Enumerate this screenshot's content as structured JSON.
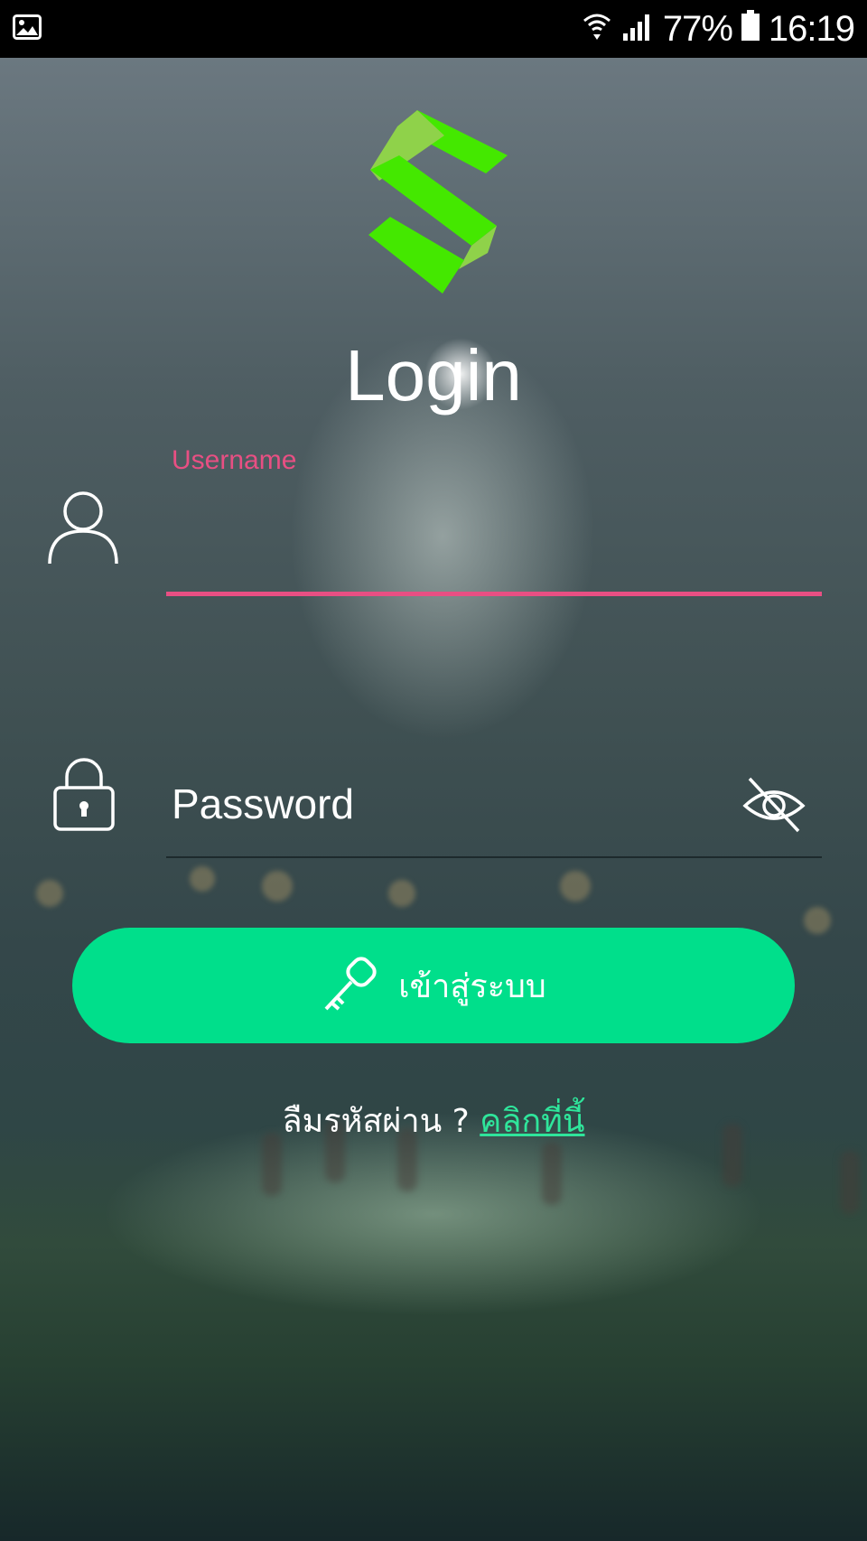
{
  "status_bar": {
    "battery": "77%",
    "time": "16:19",
    "icons": [
      "image-icon",
      "wifi-icon",
      "signal-icon",
      "battery-icon"
    ]
  },
  "login": {
    "title": "Login",
    "username_label": "Username",
    "username_value": "",
    "password_placeholder": "Password",
    "submit_label": "เข้าสู่ระบบ",
    "forgot_text": "ลืมรหัสผ่าน ?",
    "forgot_link": "คลิกที่นี้"
  },
  "colors": {
    "accent_pink": "#e84f83",
    "button_green": "#00df8b",
    "link_green": "#2fe59b",
    "logo_green": "#44e800"
  }
}
